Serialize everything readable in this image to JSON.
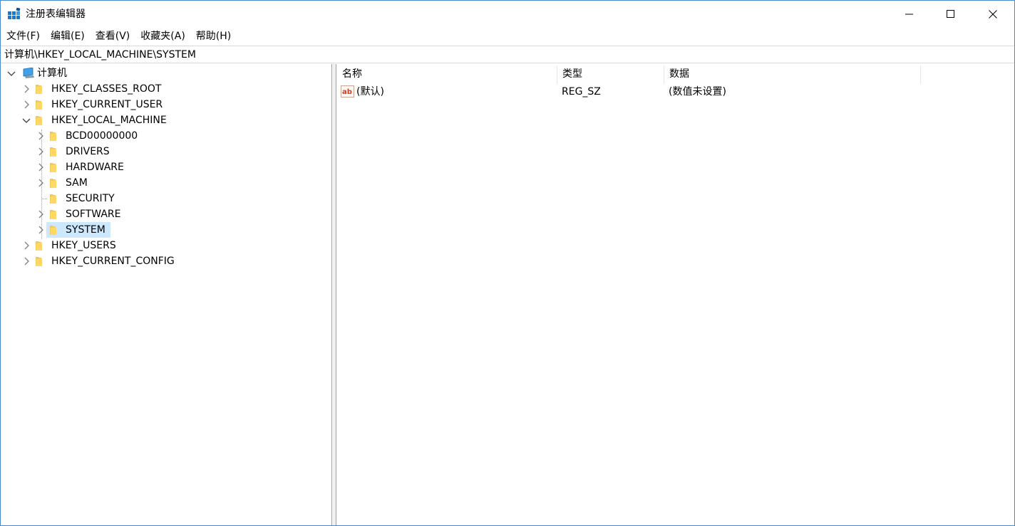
{
  "window": {
    "title": "注册表编辑器",
    "icon": "registry-editor-icon",
    "accent_color": "#4a8ac8"
  },
  "menu": [
    {
      "label": "文件(F)"
    },
    {
      "label": "编辑(E)"
    },
    {
      "label": "查看(V)"
    },
    {
      "label": "收藏夹(A)"
    },
    {
      "label": "帮助(H)"
    }
  ],
  "address": {
    "path": "计算机\\HKEY_LOCAL_MACHINE\\SYSTEM"
  },
  "tree": {
    "root": {
      "label": "计算机",
      "expanded": true,
      "icon": "computer-icon"
    },
    "hives": [
      {
        "label": "HKEY_CLASSES_ROOT",
        "expanded": false
      },
      {
        "label": "HKEY_CURRENT_USER",
        "expanded": false
      },
      {
        "label": "HKEY_LOCAL_MACHINE",
        "expanded": true
      },
      {
        "label": "HKEY_USERS",
        "expanded": false
      },
      {
        "label": "HKEY_CURRENT_CONFIG",
        "expanded": false
      }
    ],
    "hklm_children": [
      {
        "label": "BCD00000000",
        "has_children": true
      },
      {
        "label": "DRIVERS",
        "has_children": true
      },
      {
        "label": "HARDWARE",
        "has_children": true
      },
      {
        "label": "SAM",
        "has_children": true
      },
      {
        "label": "SECURITY",
        "has_children": false
      },
      {
        "label": "SOFTWARE",
        "has_children": true
      },
      {
        "label": "SYSTEM",
        "has_children": true,
        "selected": true
      }
    ],
    "selection_color": "#cce8ff"
  },
  "list": {
    "columns": [
      {
        "label": "名称"
      },
      {
        "label": "类型"
      },
      {
        "label": "数据"
      }
    ],
    "rows": [
      {
        "name": "(默认)",
        "type": "REG_SZ",
        "data": "(数值未设置)",
        "icon": "string-value-icon"
      }
    ]
  }
}
